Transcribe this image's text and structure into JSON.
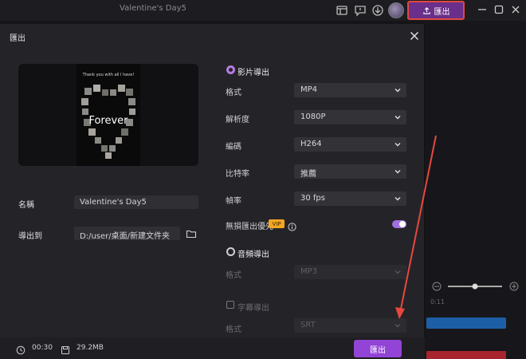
{
  "app": {
    "title": "Valentine's Day5",
    "export_label": "匯出",
    "colors": {
      "accent": "#9244d6",
      "highlight_border": "#e0483f",
      "toggle": "#a070e0",
      "vip": "#f5a623"
    }
  },
  "dialog": {
    "title": "匯出",
    "preview": {
      "caption": "Thank you with all I have!",
      "word": "Forever"
    },
    "name_label": "名稱",
    "name_value": "Valentine's Day5",
    "path_label": "導出到",
    "path_value": "D:/user/桌面/新建文件夹",
    "video_section": "影片導出",
    "rows": [
      {
        "label": "格式",
        "value": "MP4"
      },
      {
        "label": "解析度",
        "value": "1080P"
      },
      {
        "label": "編碼",
        "value": "H264"
      },
      {
        "label": "比特率",
        "value": "推薦"
      },
      {
        "label": "幀率",
        "value": "30  fps"
      }
    ],
    "lossless_label": "無損匯出優先",
    "vip_badge": "VIP",
    "audio_section": "音頻導出",
    "audio_format_label": "格式",
    "audio_format_value": "MP3",
    "subtitle_label": "字幕導出",
    "subtitle_format_label": "格式",
    "subtitle_format_value": "SRT",
    "footer": {
      "duration": "00:30",
      "size": "29.2MB",
      "export_label": "匯出"
    }
  },
  "background": {
    "timeline_mark": "0:11"
  }
}
